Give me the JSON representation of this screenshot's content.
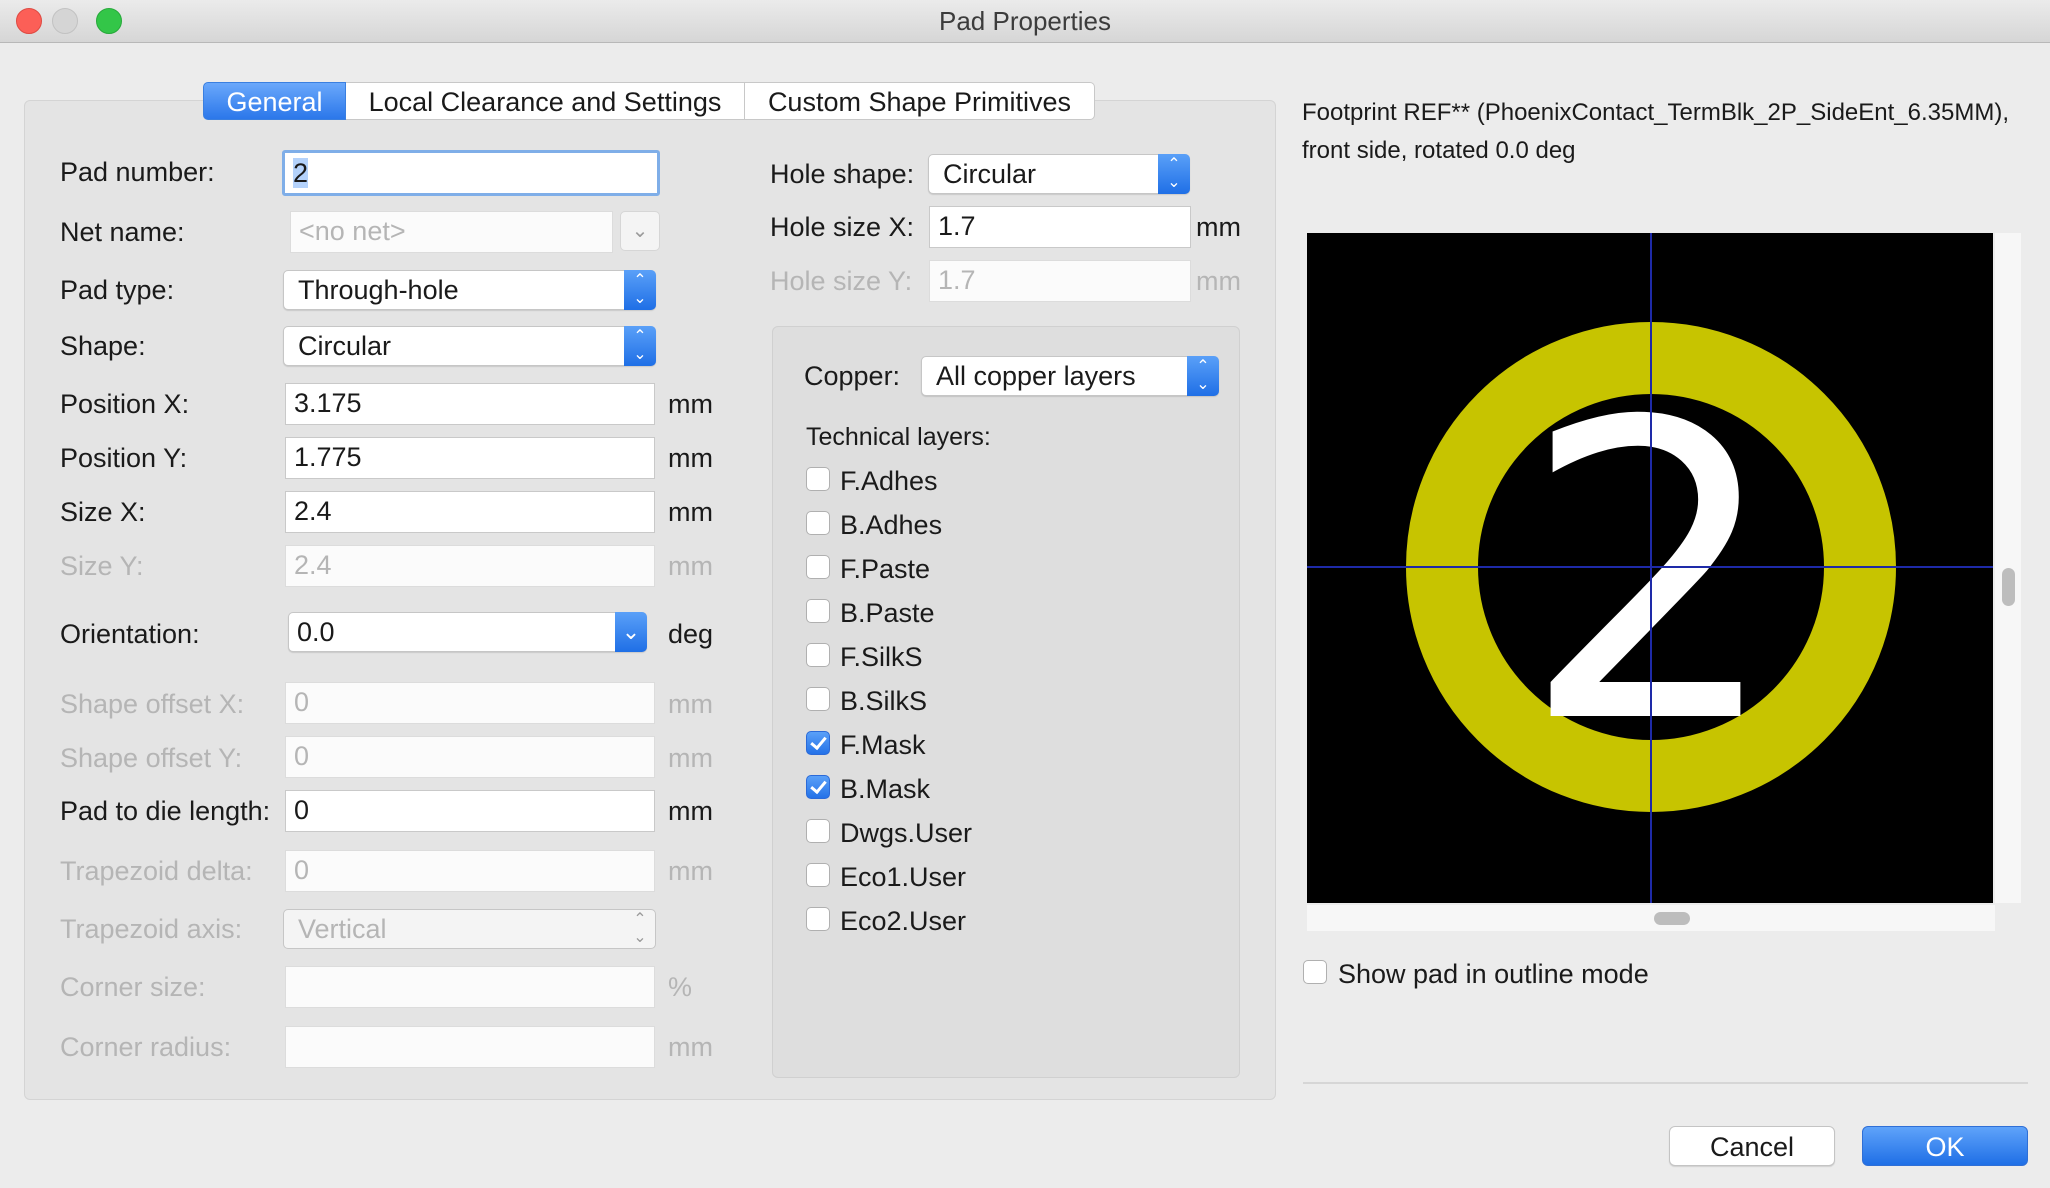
{
  "window": {
    "title": "Pad Properties"
  },
  "tabs": [
    "General",
    "Local Clearance and Settings",
    "Custom Shape Primitives"
  ],
  "general": {
    "pad_number_label": "Pad number:",
    "pad_number_value": "2",
    "net_name_label": "Net name:",
    "net_name_placeholder": "<no net>",
    "pad_type_label": "Pad type:",
    "pad_type_value": "Through-hole",
    "shape_label": "Shape:",
    "shape_value": "Circular",
    "position_x_label": "Position X:",
    "position_x_value": "3.175",
    "position_y_label": "Position Y:",
    "position_y_value": "1.775",
    "size_x_label": "Size X:",
    "size_x_value": "2.4",
    "size_y_label": "Size Y:",
    "size_y_value": "2.4",
    "orientation_label": "Orientation:",
    "orientation_value": "0.0",
    "shape_offset_x_label": "Shape offset X:",
    "shape_offset_x_value": "0",
    "shape_offset_y_label": "Shape offset Y:",
    "shape_offset_y_value": "0",
    "pad_to_die_label": "Pad to die length:",
    "pad_to_die_value": "0",
    "trap_delta_label": "Trapezoid delta:",
    "trap_delta_value": "0",
    "trap_axis_label": "Trapezoid axis:",
    "trap_axis_value": "Vertical",
    "corner_size_label": "Corner size:",
    "corner_size_value": "",
    "corner_radius_label": "Corner radius:",
    "corner_radius_value": "",
    "unit_mm": "mm",
    "unit_deg": "deg",
    "unit_pct": "%"
  },
  "hole": {
    "shape_label": "Hole shape:",
    "shape_value": "Circular",
    "size_x_label": "Hole size X:",
    "size_x_value": "1.7",
    "size_y_label": "Hole size Y:",
    "size_y_value": "1.7"
  },
  "layers": {
    "copper_label": "Copper:",
    "copper_value": "All copper layers",
    "technical_label": "Technical layers:",
    "items": [
      {
        "label": "F.Adhes",
        "checked": false
      },
      {
        "label": "B.Adhes",
        "checked": false
      },
      {
        "label": "F.Paste",
        "checked": false
      },
      {
        "label": "B.Paste",
        "checked": false
      },
      {
        "label": "F.SilkS",
        "checked": false
      },
      {
        "label": "B.SilkS",
        "checked": false
      },
      {
        "label": "F.Mask",
        "checked": true
      },
      {
        "label": "B.Mask",
        "checked": true
      },
      {
        "label": "Dwgs.User",
        "checked": false
      },
      {
        "label": "Eco1.User",
        "checked": false
      },
      {
        "label": "Eco2.User",
        "checked": false
      }
    ]
  },
  "preview": {
    "footprint_line1": "Footprint REF** (PhoenixContact_TermBlk_2P_SideEnt_6.35MM),",
    "footprint_line2": "front side, rotated 0.0 deg",
    "pad_label": "2",
    "outline_mode_label": "Show pad in outline mode",
    "colors": {
      "background": "#000000",
      "pad": "#c7c400",
      "crosshair": "#1e2aa8"
    }
  },
  "buttons": {
    "cancel": "Cancel",
    "ok": "OK"
  }
}
